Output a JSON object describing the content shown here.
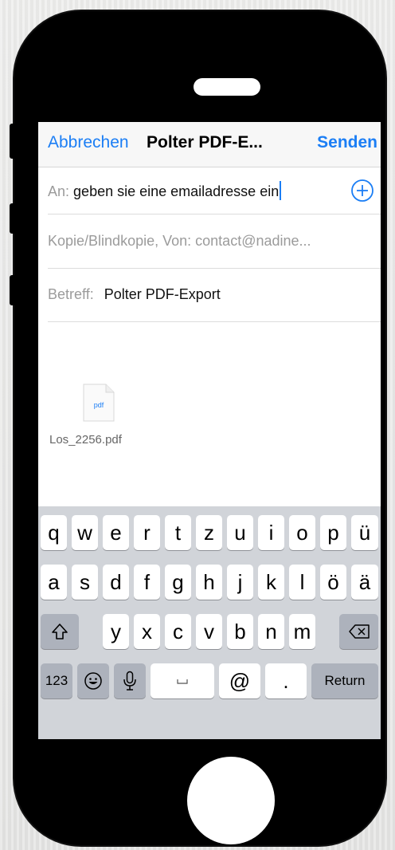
{
  "navbar": {
    "cancel_label": "Abbrechen",
    "title": "Polter PDF-E...",
    "send_label": "Senden"
  },
  "fields": {
    "to_label": "An:",
    "to_value": "geben sie eine emailadresse ein",
    "cc_label": "Kopie/Blindkopie, Von:",
    "cc_value": "contact@nadine...",
    "subject_label": "Betreff:",
    "subject_value": "Polter PDF-Export"
  },
  "attachment": {
    "icon_text": "pdf",
    "filename": "Los_2256.pdf"
  },
  "keyboard": {
    "row1": [
      "q",
      "w",
      "e",
      "r",
      "t",
      "z",
      "u",
      "i",
      "o",
      "p",
      "ü"
    ],
    "row2": [
      "a",
      "s",
      "d",
      "f",
      "g",
      "h",
      "j",
      "k",
      "l",
      "ö",
      "ä"
    ],
    "row3": [
      "y",
      "x",
      "c",
      "v",
      "b",
      "n",
      "m"
    ],
    "numbers_label": "123",
    "at_label": "@",
    "dot_label": ".",
    "return_label": "Return"
  },
  "colors": {
    "accent": "#1b7ef5",
    "keyboard_bg": "#d1d4d9",
    "special_key": "#adb2bc"
  }
}
